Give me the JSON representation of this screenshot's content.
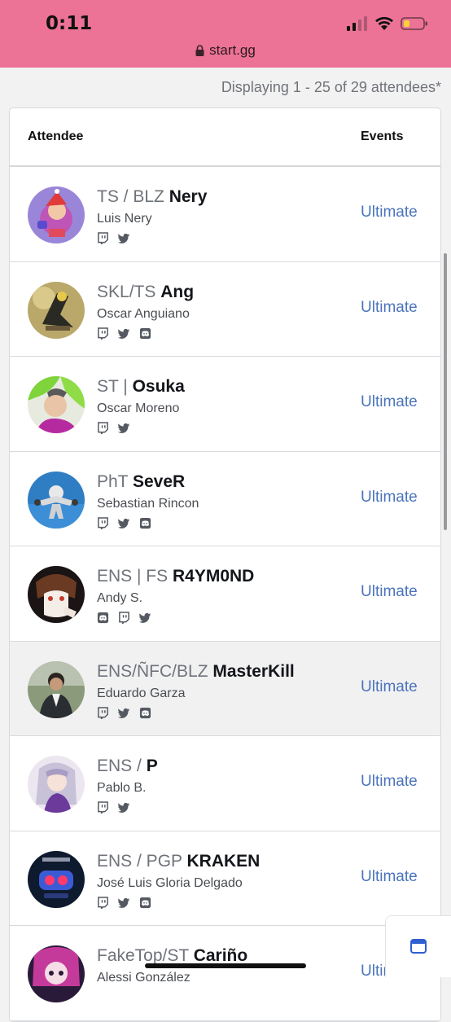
{
  "status": {
    "time": "0:11",
    "url": "start.gg"
  },
  "summary": "Displaying 1 - 25 of 29 attendees*",
  "table": {
    "headers": {
      "attendee": "Attendee",
      "events": "Events"
    },
    "rows": [
      {
        "prefix": "TS / BLZ",
        "tag": "Nery",
        "name": "Luis Nery",
        "socials": [
          "twitch-icon",
          "twitter-icon"
        ],
        "event": "Ultimate"
      },
      {
        "prefix": "SKL/TS",
        "tag": "Ang",
        "name": "Oscar Anguiano",
        "socials": [
          "twitch-icon",
          "twitter-icon",
          "discord-icon"
        ],
        "event": "Ultimate"
      },
      {
        "prefix": "ST |",
        "tag": "Osuka",
        "name": "Oscar Moreno",
        "socials": [
          "twitch-icon",
          "twitter-icon"
        ],
        "event": "Ultimate"
      },
      {
        "prefix": "PhT",
        "tag": "SeveR",
        "name": "Sebastian Rincon",
        "socials": [
          "twitch-icon",
          "twitter-icon",
          "discord-icon"
        ],
        "event": "Ultimate"
      },
      {
        "prefix": "ENS | FS",
        "tag": "R4YM0ND",
        "name": "Andy S.",
        "socials": [
          "discord-icon",
          "twitch-icon",
          "twitter-icon"
        ],
        "event": "Ultimate"
      },
      {
        "prefix": "ENS/ÑFC/BLZ",
        "tag": "MasterKill",
        "name": "Eduardo Garza",
        "socials": [
          "twitch-icon",
          "twitter-icon",
          "discord-icon"
        ],
        "event": "Ultimate"
      },
      {
        "prefix": "ENS /",
        "tag": "P",
        "name": "Pablo B.",
        "socials": [
          "twitch-icon",
          "twitter-icon"
        ],
        "event": "Ultimate"
      },
      {
        "prefix": "ENS / PGP",
        "tag": "KRAKEN",
        "name": "José Luis Gloria Delgado",
        "socials": [
          "twitch-icon",
          "twitter-icon",
          "discord-icon"
        ],
        "event": "Ultimate"
      },
      {
        "prefix": "FakeTop/ST",
        "tag": "Cariño",
        "name": "Alessi González",
        "socials": [],
        "event": "Ultimate"
      }
    ]
  },
  "colors": {
    "status_bar": "#ec7296",
    "link": "#4b74bb",
    "prefix": "#6f737a"
  }
}
